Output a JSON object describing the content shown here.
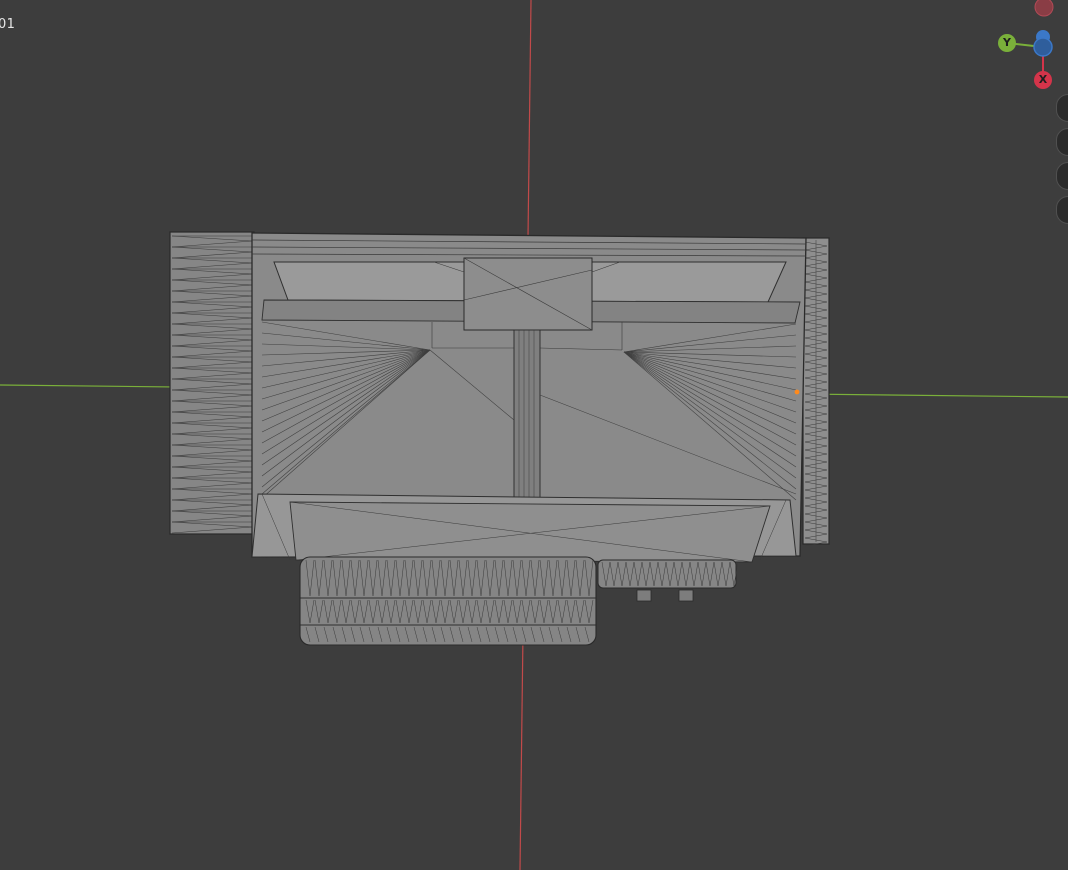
{
  "viewport": {
    "object_name_partial": "01",
    "background_color": "#3d3d3d",
    "x_axis_color": "#c24a4a",
    "y_axis_color": "#7ab03a"
  },
  "gizmo": {
    "y_label": "Y",
    "x_label": "X",
    "x_color": "#d4344a",
    "y_color": "#7ab03a",
    "z_color": "#3b78c8"
  },
  "side_tools": [
    "zoom-tool",
    "pan-tool",
    "camera-tool",
    "ortho-toggle"
  ],
  "model": {
    "name": "camera-mesh",
    "shading": "wireframe-solid",
    "mesh_color": "#8a8a8a"
  }
}
